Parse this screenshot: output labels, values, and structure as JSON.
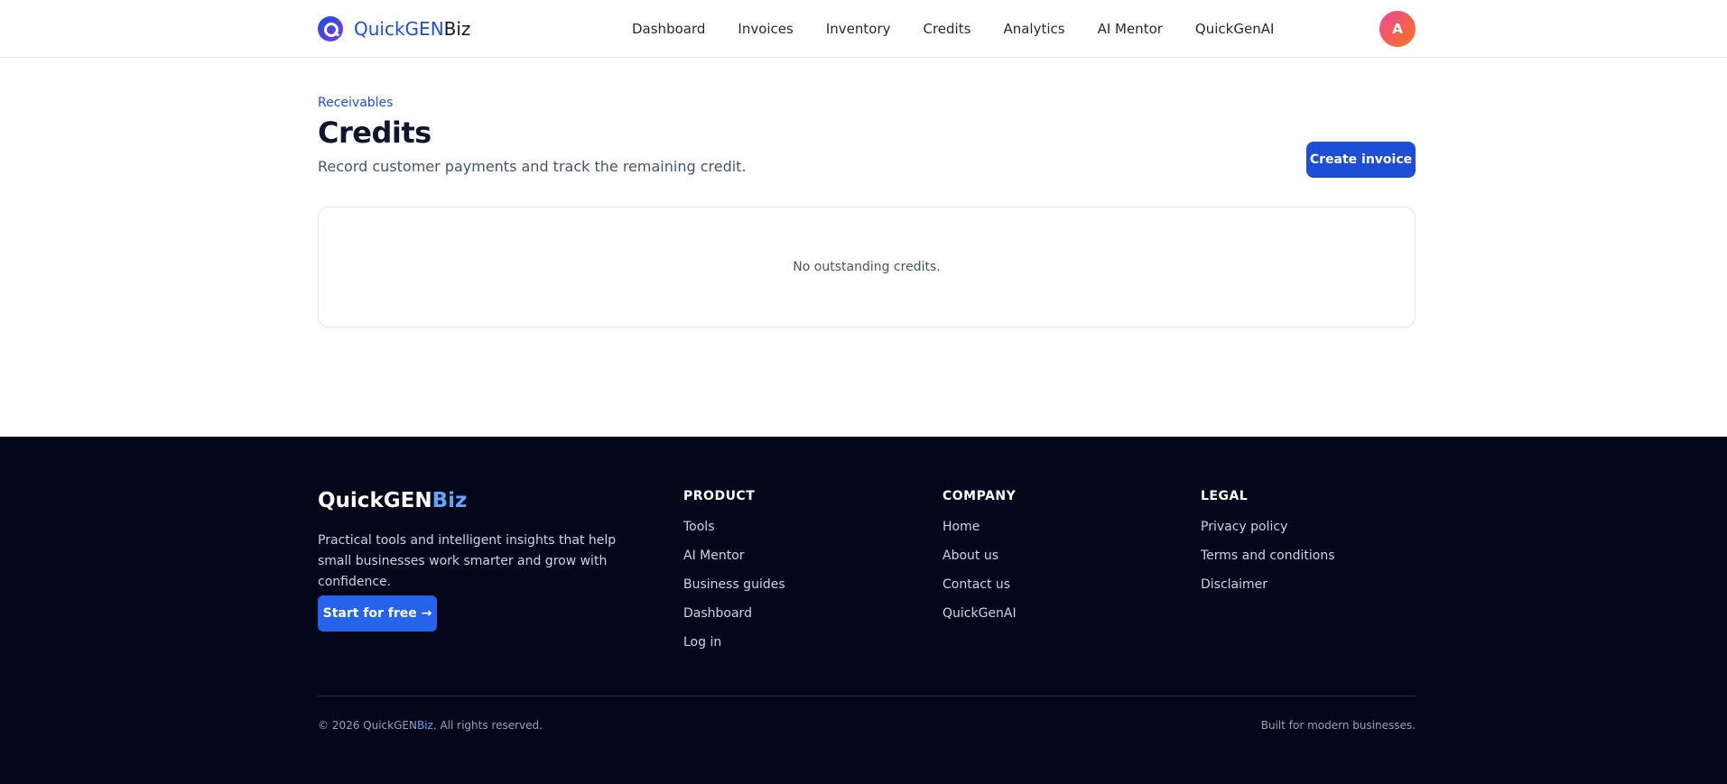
{
  "header": {
    "logo_prefix": "QuickGEN",
    "logo_suffix": "Biz",
    "nav": [
      "Dashboard",
      "Invoices",
      "Inventory",
      "Credits",
      "Analytics",
      "AI Mentor",
      "QuickGenAI"
    ],
    "avatar_initial": "A"
  },
  "main": {
    "eyebrow": "Receivables",
    "title": "Credits",
    "subtitle": "Record customer payments and track the remaining credit.",
    "create_button": "Create invoice",
    "empty_text": "No outstanding credits."
  },
  "footer": {
    "brand_prefix": "QuickGEN",
    "brand_suffix": "Biz",
    "description": "Practical tools and intelligent insights that help small businesses work smarter and grow with confidence.",
    "cta": "Start for free →",
    "columns": [
      {
        "heading": "PRODUCT",
        "links": [
          "Tools",
          "AI Mentor",
          "Business guides",
          "Dashboard",
          "Log in"
        ]
      },
      {
        "heading": "COMPANY",
        "links": [
          "Home",
          "About us",
          "Contact us",
          "QuickGenAI"
        ]
      },
      {
        "heading": "LEGAL",
        "links": [
          "Privacy policy",
          "Terms and conditions",
          "Disclaimer"
        ]
      }
    ],
    "copyright_prefix": "© 2026 QuickGEN",
    "copyright_accent": "Biz",
    "copyright_suffix": ". All rights reserved.",
    "built_for": "Built for modern businesses."
  },
  "colors": {
    "brand_blue": "#1d4ed8",
    "footer_bg": "#04061a",
    "accent_light": "#60a5fa"
  }
}
